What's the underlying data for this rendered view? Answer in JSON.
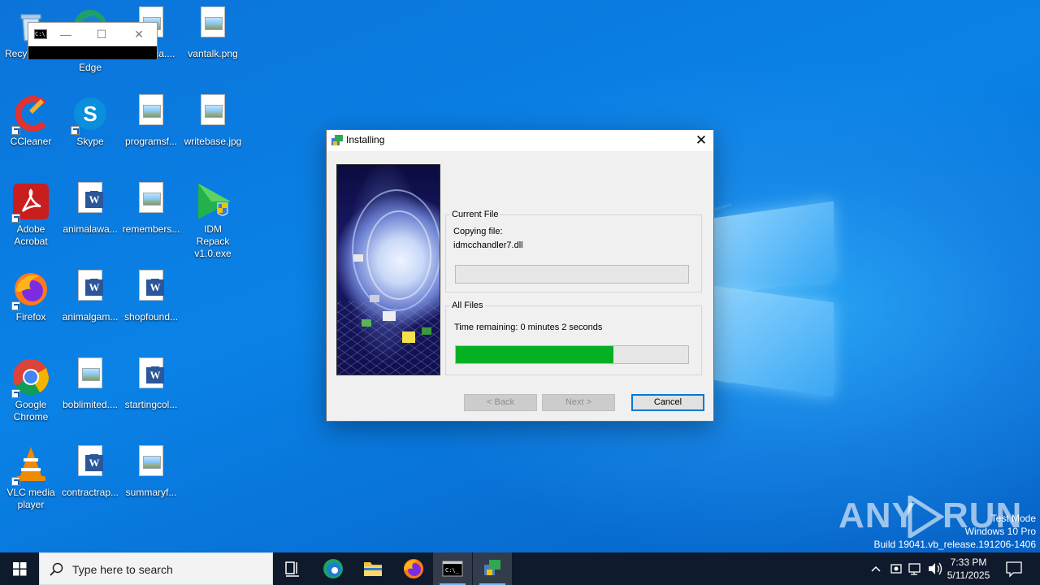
{
  "desktop": {
    "icons": [
      {
        "label": "Recycle Bin",
        "icon": "recycle-bin-icon"
      },
      {
        "label": "Edge",
        "icon": "edge-icon"
      },
      {
        "label": "mia....",
        "icon": "image-file-icon"
      },
      {
        "label": "vantalk.png",
        "icon": "image-file-icon"
      },
      {
        "label": "CCleaner",
        "icon": "ccleaner-icon"
      },
      {
        "label": "Skype",
        "icon": "skype-icon"
      },
      {
        "label": "programsf...",
        "icon": "image-file-icon"
      },
      {
        "label": "writebase.jpg",
        "icon": "image-file-icon"
      },
      {
        "label": "Adobe Acrobat",
        "icon": "acrobat-icon"
      },
      {
        "label": "animalawa...",
        "icon": "word-doc-icon"
      },
      {
        "label": "remembers...",
        "icon": "image-file-icon"
      },
      {
        "label": "IDM Repack v1.0.exe",
        "icon": "idm-installer-icon"
      },
      {
        "label": "Firefox",
        "icon": "firefox-icon"
      },
      {
        "label": "animalgam...",
        "icon": "word-doc-icon"
      },
      {
        "label": "shopfound...",
        "icon": "word-doc-icon"
      },
      {
        "label": "Google Chrome",
        "icon": "chrome-icon"
      },
      {
        "label": "boblimited....",
        "icon": "image-file-icon"
      },
      {
        "label": "startingcol...",
        "icon": "word-doc-icon"
      },
      {
        "label": "VLC media player",
        "icon": "vlc-icon"
      },
      {
        "label": "contractrap...",
        "icon": "word-doc-icon"
      },
      {
        "label": "summaryf...",
        "icon": "image-file-icon"
      }
    ]
  },
  "cmd_window": {
    "title_icon": "C:\\"
  },
  "dialog": {
    "title": "Installing",
    "current_file": {
      "legend": "Current File",
      "line1": "Copying file:",
      "line2": "idmcchandler7.dll",
      "progress_fraction": 0
    },
    "all_files": {
      "legend": "All Files",
      "time_remaining": "Time remaining: 0 minutes 2 seconds",
      "progress_fraction": 0.68
    },
    "buttons": {
      "back": "< Back",
      "next": "Next >",
      "cancel": "Cancel"
    }
  },
  "watermark": {
    "brand_left": "ANY",
    "brand_right": "RUN",
    "line1": "Test Mode",
    "line2": "Windows 10 Pro",
    "line3": "Build 19041.vb_release.191206-1406"
  },
  "taskbar": {
    "search_placeholder": "Type here to search",
    "time": "7:33 PM",
    "date": "5/11/2025"
  },
  "colors": {
    "progress_green": "#06b025",
    "taskbar": "#0f1a2c",
    "desktop_blue": "#0a78de"
  }
}
